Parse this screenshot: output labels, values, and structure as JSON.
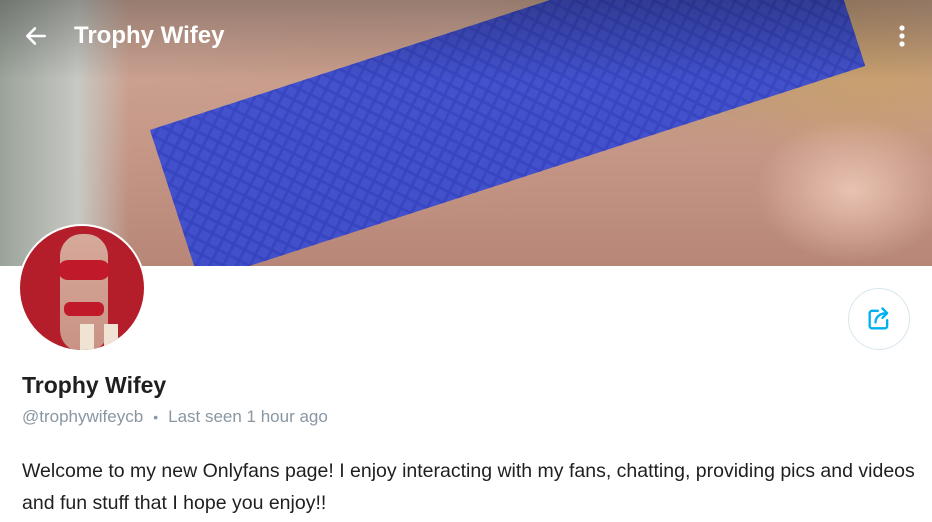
{
  "header": {
    "title": "Trophy Wifey",
    "back_icon": "arrow-left-icon",
    "more_icon": "more-vertical-icon"
  },
  "profile": {
    "display_name": "Trophy Wifey",
    "username": "@trophywifeycb",
    "last_seen": "Last seen 1 hour ago",
    "separator": "•",
    "bio": "Welcome to my new Onlyfans page! I enjoy interacting with my fans, chatting, providing pics and videos and fun stuff that I hope you enjoy!!"
  },
  "share": {
    "icon": "share-icon"
  },
  "colors": {
    "accent": "#00aff0",
    "text": "#1f1f1f",
    "muted": "#8a96a3"
  }
}
